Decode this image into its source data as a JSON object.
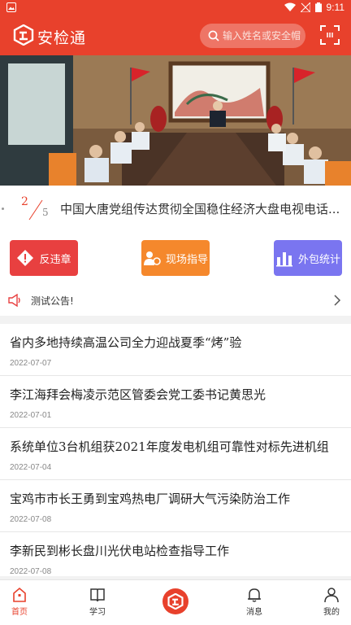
{
  "status_bar": {
    "time": "9:11"
  },
  "header": {
    "app_title": "安检通",
    "search_placeholder": "输入姓名或安全帽"
  },
  "banner": {
    "current_index": "2",
    "total": "5",
    "caption": "中国大唐党组传达贯彻全国稳住经济大盘电视电话..."
  },
  "shortcuts": [
    {
      "label": "反违章",
      "icon": "warning-icon",
      "color": "#e84040"
    },
    {
      "label": "现场指导",
      "icon": "guide-icon",
      "color": "#f5882c"
    },
    {
      "label": "外包统计",
      "icon": "bar-chart-icon",
      "color": "#7a75f0"
    }
  ],
  "notice": {
    "text": "测试公告!"
  },
  "news": [
    {
      "title": "省内多地持续高温公司全力迎战夏季“烤”验",
      "date": "2022-07-07"
    },
    {
      "title": "李江海拜会梅凌示范区管委会党工委书记黄思光",
      "date": "2022-07-01"
    },
    {
      "title": "系统单位3台机组获2021年度发电机组可靠性对标先进机组",
      "date": "2022-07-04"
    },
    {
      "title": "宝鸡市市长王勇到宝鸡热电厂调研大气污染防治工作",
      "date": "2022-07-08"
    },
    {
      "title": "李新民到彬长盘川光伏电站检查指导工作",
      "date": "2022-07-08"
    }
  ],
  "tabbar": {
    "home": "首页",
    "study": "学习",
    "messages": "消息",
    "mine": "我的"
  },
  "colors": {
    "accent": "#e8412c"
  }
}
